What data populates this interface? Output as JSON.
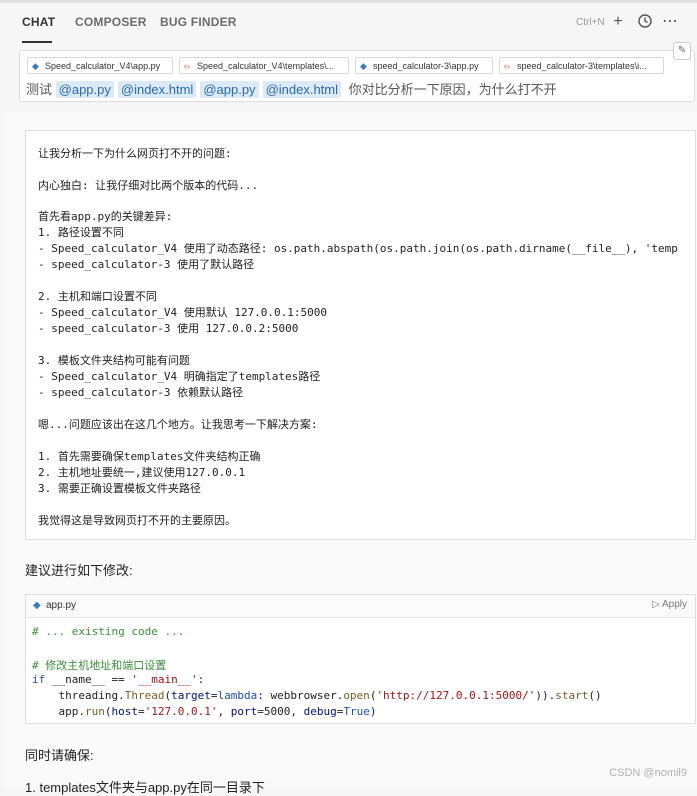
{
  "tabs": {
    "chat": "CHAT",
    "composer": "COMPOSER",
    "bugfinder": "BUG FINDER"
  },
  "toolbar": {
    "shortcut": "Ctrl+N",
    "new_icon": "plus-icon",
    "history_icon": "history-icon",
    "more_icon": "more-icon"
  },
  "context_files": [
    {
      "label": "Speed_calculator_V4\\app.py",
      "type": "py"
    },
    {
      "label": "Speed_calculator_V4\\templates\\...",
      "type": "html"
    },
    {
      "label": "speed_calculator-3\\app.py",
      "type": "py"
    },
    {
      "label": "speed_calculator-3\\templates\\i...",
      "type": "html"
    }
  ],
  "prompt": {
    "prefix": "测试",
    "mentions": [
      "@app.py",
      "@index.html",
      "@app.py",
      "@index.html"
    ],
    "text": "你对比分析一下原因，为什么打不开"
  },
  "thought": {
    "lines": [
      "让我分析一下为什么网页打不开的问题:",
      "",
      "内心独白: 让我仔细对比两个版本的代码...",
      "",
      "首先看app.py的关键差异:",
      "1. 路径设置不同",
      "- Speed_calculator_V4 使用了动态路径: os.path.abspath(os.path.join(os.path.dirname(__file__), 'temp",
      "- speed_calculator-3 使用了默认路径",
      "",
      "2. 主机和端口设置不同",
      "- Speed_calculator_V4 使用默认 127.0.0.1:5000",
      "- speed_calculator-3 使用 127.0.0.2:5000",
      "",
      "3. 模板文件夹结构可能有问题",
      "- Speed_calculator_V4 明确指定了templates路径",
      "- speed_calculator-3 依赖默认路径",
      "",
      "嗯...问题应该出在这几个地方。让我思考一下解决方案:",
      "",
      "1. 首先需要确保templates文件夹结构正确",
      "2. 主机地址要统一,建议使用127.0.0.1",
      "3. 需要正确设置模板文件夹路径",
      "",
      "我觉得这是导致网页打不开的主要原因。"
    ]
  },
  "suggestion": "建议进行如下修改:",
  "code": {
    "filename": "app.py",
    "apply_label": "Apply",
    "line1": "# ... existing code ...",
    "line2": "# 修改主机地址和端口设置",
    "line3_kw": "if",
    "line3_rest": " __name__ == ",
    "line3_str": "'__main__'",
    "line3_end": ":",
    "line4_a": "    threading.",
    "line4_fn": "Thread",
    "line4_b": "(",
    "line4_p": "target",
    "line4_c": "=",
    "line4_kw": "lambda",
    "line4_d": ": webbrowser.",
    "line4_fn2": "open",
    "line4_e": "(",
    "line4_str": "'http://127.0.0.1:5000/'",
    "line4_f": ")).",
    "line4_fn3": "start",
    "line4_g": "()",
    "line5_a": "    app.",
    "line5_fn": "run",
    "line5_b": "(",
    "line5_p1": "host",
    "line5_c": "=",
    "line5_str": "'127.0.0.1'",
    "line5_d": ", ",
    "line5_p2": "port",
    "line5_e": "=5000, ",
    "line5_p3": "debug",
    "line5_f": "=",
    "line5_kw": "True",
    "line5_g": ")"
  },
  "also": "同时请确保:",
  "list_partial": "1. templates文件夹与app.py在同一目录下",
  "watermark": "CSDN @nomil9"
}
